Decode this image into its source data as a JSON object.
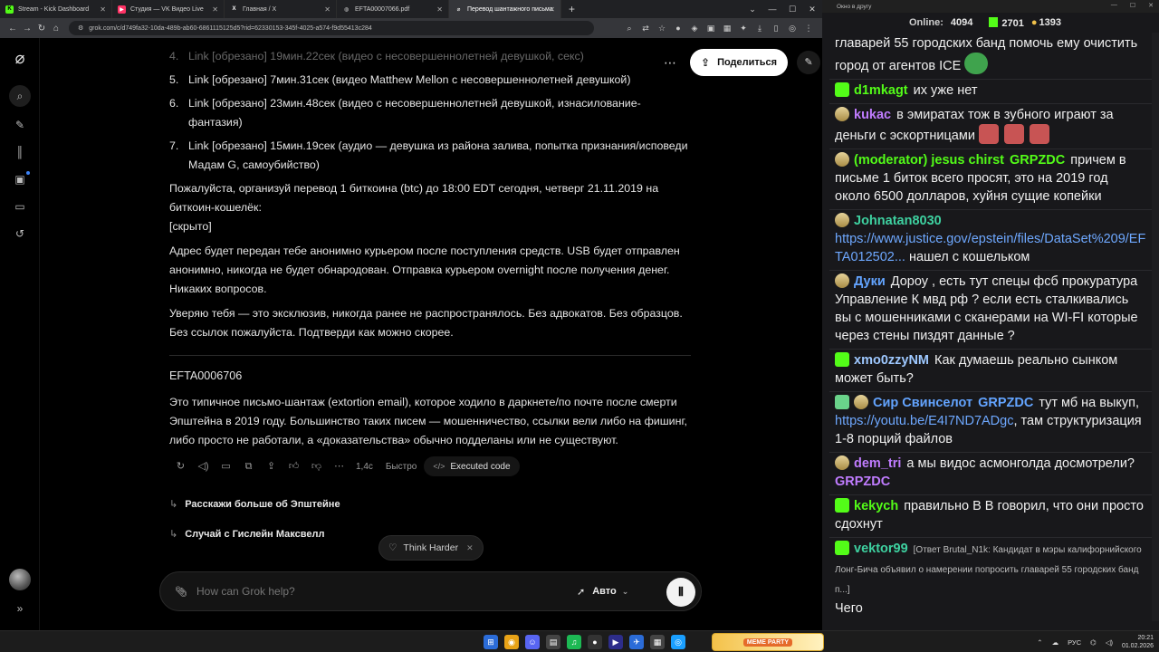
{
  "browser": {
    "tabs": [
      {
        "label": "Stream - Kick Dashboard",
        "fav_color": "#53fc18",
        "fav_glyph": "K"
      },
      {
        "label": "Студия — VK Видео Live",
        "fav_color": "#ff3366",
        "fav_glyph": "▶"
      },
      {
        "label": "Главная / X",
        "fav_color": "#202124",
        "fav_glyph": "X"
      },
      {
        "label": "EFTA00007066.pdf",
        "fav_color": "#202124",
        "fav_glyph": "◍"
      },
      {
        "label": "Перевод шантажного письма",
        "fav_color": "#202124",
        "fav_glyph": "⌀"
      }
    ],
    "url": "grok.com/c/d749fa32-10da-489b-ab60-6861115125d5?rid=62330153-345f-4025-a574-f9d55413c284"
  },
  "grok": {
    "share_label": "Поделиться",
    "list": [
      {
        "num": "4.",
        "text": "Link [обрезано] 19мин.22сек (видео с несовершеннолетней девушкой, секс)"
      },
      {
        "num": "5.",
        "text": "Link [обрезано] 7мин.31сек (видео Matthew Mellon с несовершеннолетней девушкой)"
      },
      {
        "num": "6.",
        "text": "Link [обрезано] 23мин.48сек (видео с несовершеннолетней девушкой, изнасилование-фантазия)"
      },
      {
        "num": "7.",
        "text": "Link [обрезано] 15мин.19сек (аудио — девушка из района залива, попытка признания/исповеди Мадам G, самоубийство)"
      }
    ],
    "p1": "Пожалуйста, организуй перевод 1 биткоина (btc) до 18:00 EDT сегодня, четверг 21.11.2019 на биткоин-кошелёк:",
    "p1_hidden": "[скрыто]",
    "p2": "Адрес будет передан тебе анонимно курьером после поступления средств. USB будет отправлен анонимно, никогда не будет обнародован. Отправка курьером overnight после получения денег. Никаких вопросов.",
    "p3": "Уверяю тебя — это эксклюзив, никогда ранее не распространялось. Без адвокатов. Без образцов. Без ссылок пожалуйста. Подтверди как можно скорее.",
    "efta": "EFTA0006706",
    "summary": "Это типичное письмо-шантаж (extortion email), которое ходило в даркнете/по почте после смерти Эпштейна в 2019 году. Большинство таких писем — мошенничество, ссылки вели либо на фишинг, либо просто не работали, а «доказательства» обычно подделаны или не существуют.",
    "meta_time": "1,4с",
    "meta_mode": "Быстро",
    "executed_code": "Executed code",
    "suggestions": [
      "Расскажи больше об Эпштейне",
      "Случай с Гислейн Максвелл"
    ],
    "think_harder": "Think Harder",
    "composer_placeholder": "How can Grok help?",
    "mode_label": "Авто"
  },
  "chat": {
    "window_title": "Окно в другу",
    "online_label": "Online:",
    "online_count": "4094",
    "kick_count": "2701",
    "subs_count": "1393",
    "messages": [
      {
        "user": "",
        "color": "#efefef",
        "text": "главарей 55 городских банд помочь ему очистить город от агентов ICE"
      },
      {
        "user": "d1mkagt",
        "color": "#53fc18",
        "text": "их уже нет"
      },
      {
        "user": "kukac",
        "color": "#c07cff",
        "text": "в эмиратах тож в зубного играют за деньги с эскортницами"
      },
      {
        "user": "(moderator) jesus chirst",
        "color": "#53fc18",
        "mention": "GRPZDC",
        "text": "причем в письме 1 биток всего просят, это на 2019 год около 6500 долларов, хуйня сущие копейки"
      },
      {
        "user": "Johnatan8030",
        "color": "#3ed1a0",
        "link": "https://www.justice.gov/epstein/files/DataSet%209/EFTA012502...",
        "text": "нашел с кошельком"
      },
      {
        "user": "Дуки",
        "color": "#63a4ff",
        "text": "Дороу , есть тут спецы фсб прокуратура Управление К мвд рф ? если есть сталкивались вы с мошенниками с сканерами на WI-FI  которые через стены пиздят данные ?"
      },
      {
        "user": "xmo0zzyNM",
        "color": "#9ec8ff",
        "text": "Как думаешь реально сынком может быть?"
      },
      {
        "user": "Сир Свинселот",
        "color": "#63a4ff",
        "mention": "GRPZDC",
        "text_a": "тут мб на выкуп,",
        "link": "https://youtu.be/E4I7ND7ADgc",
        "text": ", там структуризация 1-8 порций файлов"
      },
      {
        "user": "dem_tri",
        "color": "#c07cff",
        "text": "а мы видос асмонголда досмотрели?",
        "mention_after": "GRPZDC"
      },
      {
        "user": "kekych",
        "color": "#53fc18",
        "text": "правильно В В говорил, что они просто сдохнут"
      },
      {
        "user": "vektor99",
        "color": "#3ed1a0",
        "reply": "[Ответ Brutal_N1k: Кандидат в мэры калифорнийского Лонг-Бича объявил о намерении попросить главарей 55 городских банд п...]",
        "text": "Чего"
      }
    ]
  },
  "taskbar": {
    "banner": "MEME PARTY",
    "lang": "РУС",
    "time": "20:21",
    "date": "01.02.2026"
  }
}
